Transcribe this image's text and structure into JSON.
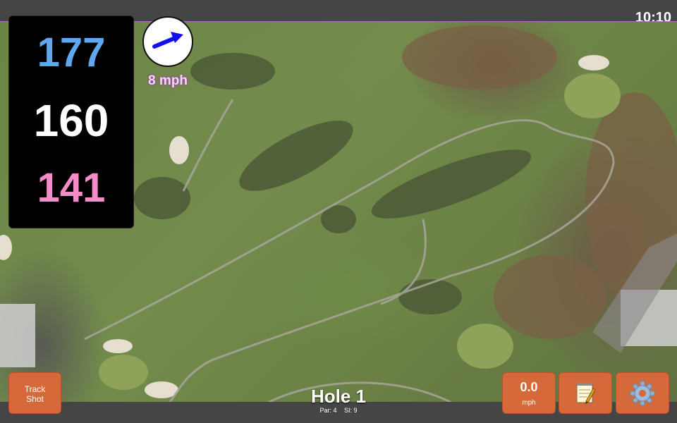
{
  "status": {
    "time": "10:10"
  },
  "distances": {
    "back": "177",
    "middle": "160",
    "front": "141"
  },
  "wind": {
    "speed_label": "8 mph",
    "icon": "wind-direction-arrow-icon"
  },
  "hole": {
    "title": "Hole 1",
    "par": "Par: 4",
    "stroke_index": "SI: 9"
  },
  "buttons": {
    "track_shot_line1": "Track",
    "track_shot_line2": "Shot",
    "speed_value": "0.0",
    "speed_unit": "mph",
    "notes_icon": "notepad-icon",
    "settings_icon": "gear-icon"
  },
  "colors": {
    "back_distance": "#5fa8ee",
    "middle_distance": "#ffffff",
    "front_distance": "#f58ac8",
    "button": "#d6693a"
  }
}
